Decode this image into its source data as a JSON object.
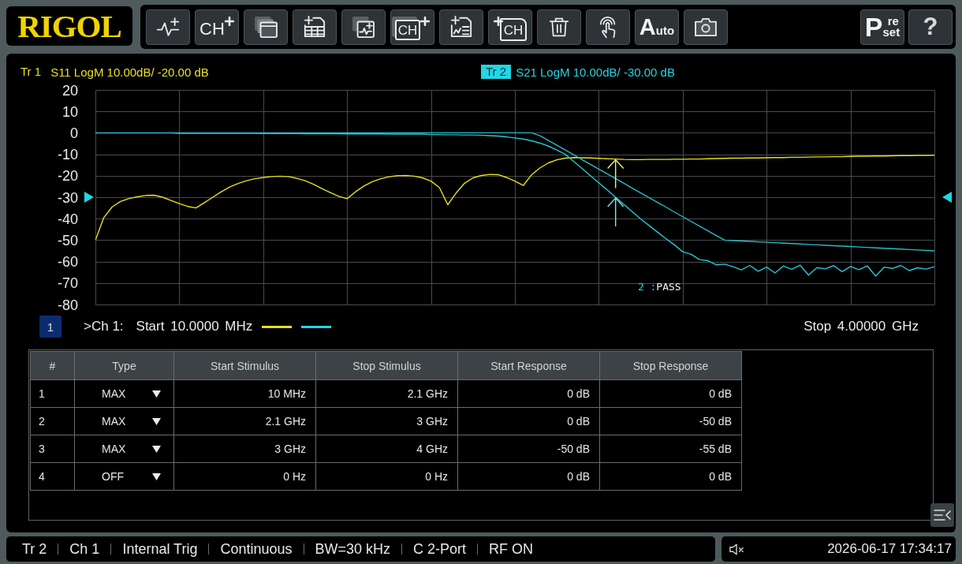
{
  "logo": "RIGOL",
  "toolbar": {
    "left": [
      {
        "kind": "trace"
      },
      {
        "kind": "channel",
        "label": "CH"
      },
      {
        "kind": "window"
      },
      {
        "kind": "table"
      },
      {
        "kind": "tracewin"
      },
      {
        "kind": "chwin",
        "label": "CH"
      },
      {
        "kind": "limit"
      },
      {
        "kind": "chfile",
        "label": "CH"
      },
      {
        "kind": "delete"
      },
      {
        "kind": "touch"
      },
      {
        "kind": "auto",
        "label": "Auto"
      },
      {
        "kind": "screenshot"
      }
    ],
    "right": [
      {
        "kind": "preset",
        "label": "P",
        "upper": "re",
        "lower": "set"
      },
      {
        "kind": "help",
        "label": "?"
      }
    ]
  },
  "display": {
    "traces": [
      {
        "label": "Tr 1",
        "selected": false,
        "description": "S11 LogM 10.00dB/ -20.00 dB",
        "color": "#e6e01c"
      },
      {
        "label": "Tr 2",
        "selected": true,
        "description": "S21 LogM 10.00dB/ -30.00 dB",
        "color": "#22d6e4"
      }
    ],
    "chart_data": {
      "type": "line",
      "grid": true,
      "categories": [
        null,
        null,
        null,
        null,
        null,
        null,
        null,
        null,
        null,
        null,
        null,
        null,
        null,
        null,
        null,
        null,
        null,
        null,
        null,
        null,
        null,
        null,
        null,
        null,
        null,
        null,
        null,
        null,
        null,
        null,
        null,
        null,
        null,
        null,
        null,
        null,
        null,
        null,
        null,
        null,
        null,
        null,
        null,
        null,
        null,
        null,
        null,
        null,
        null,
        null,
        null,
        null,
        null,
        null,
        null,
        null,
        null,
        null,
        null,
        null,
        null,
        null,
        null,
        null,
        null,
        null,
        null,
        null,
        null,
        null,
        null,
        null,
        null,
        null,
        null,
        null,
        null,
        null,
        null,
        null,
        null,
        null,
        null,
        null,
        null,
        null,
        null,
        null,
        null,
        null,
        null,
        null,
        null,
        null,
        null,
        null,
        null,
        null,
        null,
        null,
        null
      ],
      "ylim": [
        -80,
        20
      ],
      "yticks": [
        20,
        10,
        0,
        -10,
        -20,
        -30,
        -40,
        -50,
        -60,
        -70,
        -80
      ],
      "series": [
        {
          "color": "#e6e01c",
          "values": [
            -50,
            -39.5,
            -34.5,
            -32,
            -30.6,
            -29.8,
            -29.2,
            -29.1,
            -30,
            -31.5,
            -33,
            -34.3,
            -35,
            -32.5,
            -30,
            -27.5,
            -25.3,
            -23.6,
            -22.3,
            -21.4,
            -20.8,
            -20.4,
            -20.2,
            -20.4,
            -21.2,
            -22.3,
            -24,
            -26,
            -27.8,
            -29.6,
            -30.7,
            -27.5,
            -24.8,
            -22.8,
            -21.4,
            -20.5,
            -20,
            -19.9,
            -20.2,
            -21,
            -22.5,
            -25.5,
            -33.5,
            -28,
            -23.5,
            -21,
            -19.9,
            -19.4,
            -19.5,
            -20.8,
            -22.5,
            -24.5,
            -19.5,
            -16.3,
            -14,
            -12.6,
            -11.8,
            -11.5,
            -11.6,
            -11.7,
            -11.9,
            -12.1,
            -12.2,
            -12.4,
            -12.5,
            -12.5,
            -12.4,
            -12.4,
            -12.4,
            -12.3,
            -12.3,
            -12.2,
            -12.2,
            -12.1,
            -12.0,
            -11.9,
            -11.8,
            -11.8,
            -11.7,
            -11.7,
            -11.6,
            -11.5,
            -11.5,
            -11.4,
            -11.4,
            -11.3,
            -11.2,
            -11.2,
            -11.1,
            -11.1,
            -11.0,
            -10.9,
            -10.9,
            -10.8,
            -10.8,
            -10.7,
            -10.6,
            -10.6,
            -10.5,
            -10.5,
            -10.4
          ]
        },
        {
          "color": "#22c8d6",
          "values": [
            -0.1,
            -0.1,
            -0.1,
            -0.1,
            -0.1,
            -0.1,
            -0.1,
            -0.1,
            -0.1,
            -0.1,
            -0.2,
            -0.2,
            -0.2,
            -0.2,
            -0.2,
            -0.2,
            -0.2,
            -0.2,
            -0.2,
            -0.2,
            -0.3,
            -0.3,
            -0.3,
            -0.3,
            -0.3,
            -0.4,
            -0.4,
            -0.4,
            -0.4,
            -0.4,
            -0.5,
            -0.5,
            -0.5,
            -0.5,
            -0.5,
            -0.6,
            -0.6,
            -0.6,
            -0.6,
            -0.6,
            -0.8,
            -0.8,
            -0.9,
            -0.9,
            -1.0,
            -1.0,
            -1.1,
            -1.3,
            -1.5,
            -1.9,
            -2.4,
            -2.9,
            -3.7,
            -4.8,
            -6.2,
            -8.0,
            -10.0,
            -13.3,
            -16.6,
            -20.0,
            -23.3,
            -26.6,
            -30.0,
            -33.4,
            -36.8,
            -40.2,
            -43.2,
            -46.3,
            -49.3,
            -52.2,
            -55.4,
            -56.6,
            -59.1,
            -59.6,
            -61.5,
            -61.2,
            -62.4,
            -63.9,
            -61.8,
            -64.5,
            -62.6,
            -65.3,
            -62.1,
            -63.6,
            -61.7,
            -66.3,
            -62.8,
            -63.4,
            -61.9,
            -64.7,
            -62.3,
            -63.8,
            -62.0,
            -66.8,
            -62.6,
            -63.2,
            -61.8,
            -64.2,
            -62.9,
            -63.5,
            -62.4
          ]
        },
        {
          "color": "#26bcc8",
          "values": [
            0,
            0,
            0,
            0,
            0,
            0,
            0,
            0,
            0,
            0,
            0,
            0,
            0,
            0,
            0,
            0,
            0,
            0,
            0,
            0,
            0,
            0,
            0,
            0,
            0,
            0,
            0,
            0,
            0,
            0,
            0,
            0,
            0,
            0,
            0,
            0,
            0,
            0,
            0,
            0,
            0,
            0,
            0,
            0,
            0,
            0,
            0,
            0,
            0,
            0,
            0,
            0,
            0,
            -1.4,
            -3.6,
            -5.8,
            -8.0,
            -10.2,
            -12.5,
            -14.7,
            -16.9,
            -19.1,
            -21.3,
            -23.5,
            -25.8,
            -28.0,
            -30.2,
            -32.4,
            -34.6,
            -36.9,
            -39.1,
            -41.3,
            -43.5,
            -45.7,
            -47.9,
            -50,
            -50.2,
            -50.4,
            -50.6,
            -50.8,
            -51.0,
            -51.2,
            -51.4,
            -51.6,
            -51.8,
            -52.0,
            -52.2,
            -52.4,
            -52.6,
            -52.8,
            -53.0,
            -53.2,
            -53.4,
            -53.6,
            -53.8,
            -54.0,
            -54.2,
            -54.4,
            -54.6,
            -54.8,
            -55.0
          ]
        }
      ]
    },
    "limit_test": {
      "trace": "2 :",
      "result": "PASS"
    },
    "channel": {
      "number": "1",
      "label": ">Ch 1:",
      "start": "Start 10.0000 MHz",
      "stop": "Stop 4.00000 GHz"
    },
    "limit_table": {
      "columns": [
        "#",
        "Type",
        "Start Stimulus",
        "Stop Stimulus",
        "Start Response",
        "Stop Response"
      ],
      "rows": [
        [
          "1",
          "MAX",
          "10 MHz",
          "2.1 GHz",
          "0 dB",
          "0 dB"
        ],
        [
          "2",
          "MAX",
          "2.1 GHz",
          "3 GHz",
          "0 dB",
          "-50 dB"
        ],
        [
          "3",
          "MAX",
          "3 GHz",
          "4 GHz",
          "-50 dB",
          "-55 dB"
        ],
        [
          "4",
          "OFF",
          "0 Hz",
          "0 Hz",
          "0 dB",
          "0 dB"
        ]
      ]
    }
  },
  "status_bar": {
    "items": [
      "Tr 2",
      "Ch 1",
      "Internal Trig",
      "Continuous",
      "BW=30 kHz",
      "C 2-Port",
      "RF ON"
    ],
    "muted": true,
    "datetime": "2026-06-17 17:34:17"
  }
}
